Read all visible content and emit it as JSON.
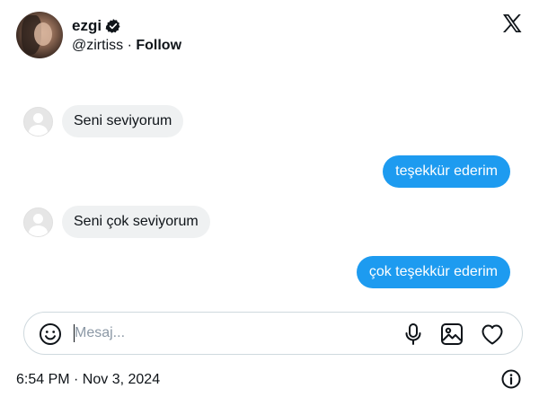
{
  "profile": {
    "display_name": "ezgi",
    "handle": "@zirtiss",
    "separator": "·",
    "follow_label": "Follow"
  },
  "messages": [
    {
      "direction": "in",
      "text": "Seni seviyorum"
    },
    {
      "direction": "out",
      "text": "teşekkür ederim"
    },
    {
      "direction": "in",
      "text": "Seni çok seviyorum"
    },
    {
      "direction": "out",
      "text": "çok teşekkür ederim"
    }
  ],
  "composer": {
    "placeholder": "Mesaj..."
  },
  "footer": {
    "timestamp": "6:54 PM · Nov 3, 2024"
  },
  "icons": {
    "brand": "x-logo-icon",
    "verified": "verified-badge-icon",
    "emoji": "emoji-icon",
    "mic": "microphone-icon",
    "image": "image-icon",
    "heart": "heart-icon",
    "info": "info-icon"
  },
  "colors": {
    "accent": "#1d9bf0",
    "incoming_bubble": "#eff1f2",
    "text": "#0f1419",
    "placeholder": "#8b98a5",
    "border": "#cfd9de"
  }
}
